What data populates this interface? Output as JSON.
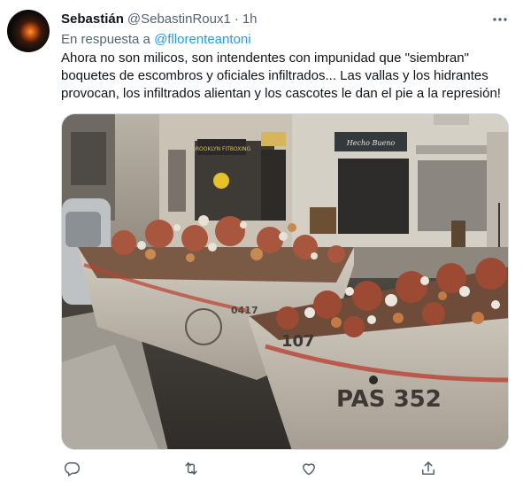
{
  "tweet": {
    "display_name": "Sebastián",
    "handle": "@SebastinRoux1",
    "separator": "·",
    "time": "1h",
    "reply_prefix": "En respuesta a",
    "reply_mention": "@fllorenteantoni",
    "text_lines": [
      "Ahora no son milicos, son intendentes con impunidad que \"siembran\"",
      "boquetes de escombros y oficiales infiltrados... Las vallas y los hidrantes",
      "provocan, los infiltrados alientan y los cascotes le dan el pie a la represión!"
    ],
    "icons": {
      "more": "more-horizontal-icon",
      "reply": "reply-icon",
      "retweet": "retweet-icon",
      "like": "heart-icon",
      "share": "share-icon"
    },
    "colors": {
      "text": "#0f1419",
      "secondary": "#536471",
      "link": "#1d9bf0",
      "border": "#cfd9de"
    }
  },
  "photo": {
    "storefront_signs": [
      "BROOKLYN FITBOXING",
      "Hecho Bueno"
    ],
    "container_markings": [
      "107",
      "PAS 352",
      "0417"
    ]
  }
}
